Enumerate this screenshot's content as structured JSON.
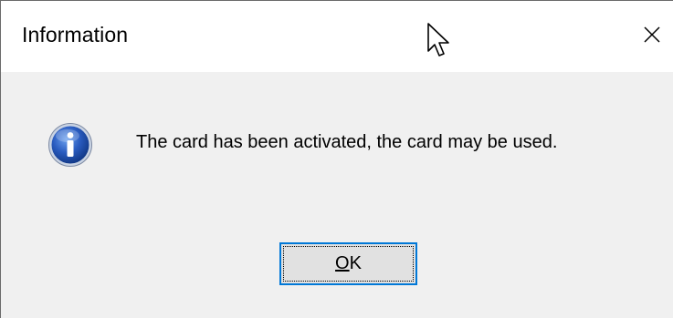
{
  "dialog": {
    "title": "Information",
    "message": "The card has been activated, the card may be used.",
    "icon": "information-icon",
    "close_icon": "close-icon",
    "ok_button": {
      "label_mnemonic": "O",
      "label_rest": "K"
    }
  },
  "colors": {
    "titlebar_bg": "#ffffff",
    "body_bg": "#f0f0f0",
    "button_bg": "#e1e1e1",
    "focus_border": "#0078d7",
    "icon_blue": "#1f4fa8"
  }
}
